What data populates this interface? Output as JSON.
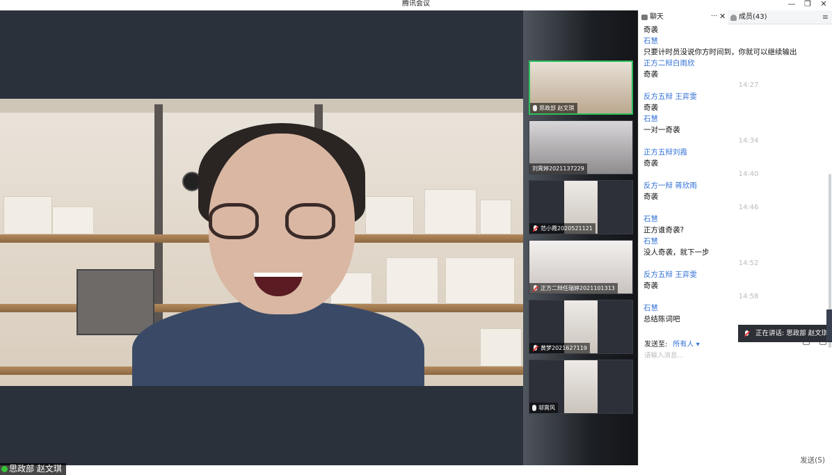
{
  "window": {
    "title": "腾讯会议",
    "min": "—",
    "restore": "❐",
    "close": "✕"
  },
  "main_video": {
    "speaker_name": "思政部 赵文琪"
  },
  "thumbnails": [
    {
      "name": "思政部 赵文琪",
      "mic": "on",
      "active": true
    },
    {
      "name": "刘霄婷2021137229",
      "mic": "none",
      "active": false
    },
    {
      "name": "范小霞2020521121",
      "mic": "off",
      "active": false
    },
    {
      "name": "正方二辩任瑞婷2021101313",
      "mic": "off",
      "active": false
    },
    {
      "name": "黄梦2021627119",
      "mic": "off",
      "active": false
    },
    {
      "name": "邬霄风",
      "mic": "on",
      "active": false
    }
  ],
  "chat_panel": {
    "tab_chat": "聊天",
    "tab_more": "···",
    "tab_close": "✕",
    "tab_members": "成员(43)",
    "menu": "≡",
    "messages": [
      {
        "type": "body",
        "text": "奇袭"
      },
      {
        "type": "sender",
        "text": "石慧"
      },
      {
        "type": "body",
        "text": "只要计时员没说你方时间到，你就可以继续输出"
      },
      {
        "type": "sender",
        "text": "正方二辩白雨欣"
      },
      {
        "type": "body",
        "text": "奇袭"
      },
      {
        "type": "time",
        "text": "14:27"
      },
      {
        "type": "sender",
        "text": "反方五辩 王弈雯"
      },
      {
        "type": "body",
        "text": "奇袭"
      },
      {
        "type": "sender",
        "text": "石慧"
      },
      {
        "type": "body",
        "text": "一对一奇袭"
      },
      {
        "type": "time",
        "text": "14:34"
      },
      {
        "type": "sender",
        "text": "正方五辩刘霞"
      },
      {
        "type": "body",
        "text": "奇袭"
      },
      {
        "type": "time",
        "text": "14:40"
      },
      {
        "type": "sender",
        "text": "反方一辩  蒋欣雨"
      },
      {
        "type": "body",
        "text": "奇袭"
      },
      {
        "type": "time",
        "text": "14:46"
      },
      {
        "type": "sender",
        "text": "石慧"
      },
      {
        "type": "body",
        "text": "正方谁奇袭?"
      },
      {
        "type": "sender",
        "text": "石慧"
      },
      {
        "type": "body",
        "text": "没人奇袭，就下一步"
      },
      {
        "type": "time",
        "text": "14:52"
      },
      {
        "type": "sender",
        "text": "反方五辩 王弈雯"
      },
      {
        "type": "body",
        "text": "奇袭"
      },
      {
        "type": "time",
        "text": "14:58"
      },
      {
        "type": "sender",
        "text": "石慧"
      },
      {
        "type": "body",
        "text": "总结陈词吧"
      }
    ],
    "send_to_label": "发送至:",
    "send_to_value": "所有人",
    "send_to_arrow": "▾",
    "input_placeholder": "请输入消息...",
    "send_button": "发送(S)"
  },
  "speaking_banner": {
    "text": "正在讲话: 思政部 赵文琪"
  }
}
